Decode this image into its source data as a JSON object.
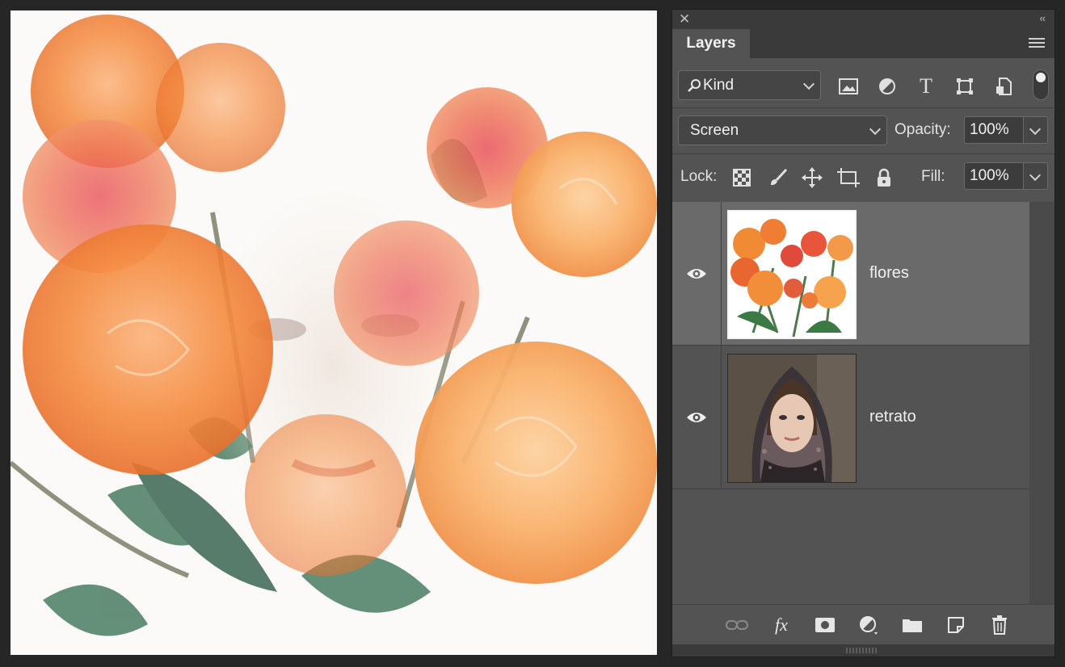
{
  "canvas": {
    "image_description_icon": "composite-image"
  },
  "panel": {
    "close_icon": "close-icon",
    "collapse_label": "‹‹",
    "tab_title": "Layers",
    "menu_icon": "panel-menu-icon",
    "filter": {
      "kind_label": "Kind",
      "icons": [
        "image-filter-icon",
        "adjustment-filter-icon",
        "type-filter-icon",
        "shape-filter-icon",
        "smart-object-filter-icon"
      ],
      "type_glyph": "T"
    },
    "blend_mode": "Screen",
    "opacity_label": "Opacity:",
    "opacity_value": "100%",
    "lock_label": "Lock:",
    "fill_label": "Fill:",
    "fill_value": "100%",
    "layers": [
      {
        "name": "flores",
        "selected": true,
        "visible": true
      },
      {
        "name": "retrato",
        "selected": false,
        "visible": true
      }
    ],
    "footer_fx": "fx"
  },
  "colors": {
    "panel_bg": "#535353",
    "selected_row": "#6a6a6a",
    "app_bg": "#262626"
  }
}
